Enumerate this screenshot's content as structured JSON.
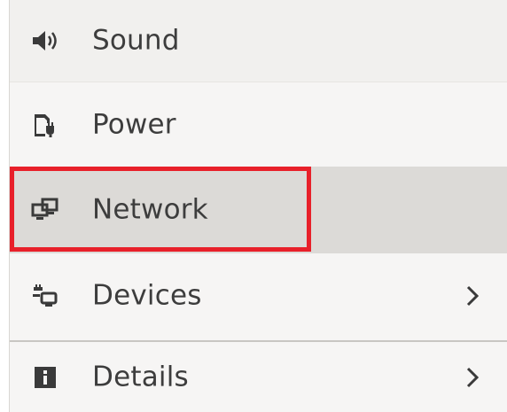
{
  "sidebar": {
    "items": [
      {
        "label": "Sound",
        "icon": "speaker-icon",
        "has_chevron": false
      },
      {
        "label": "Power",
        "icon": "power-plug-icon",
        "has_chevron": false
      },
      {
        "label": "Network",
        "icon": "network-icon",
        "has_chevron": false,
        "selected": true
      },
      {
        "label": "Devices",
        "icon": "devices-icon",
        "has_chevron": true
      },
      {
        "label": "Details",
        "icon": "info-icon",
        "has_chevron": true
      }
    ]
  },
  "colors": {
    "text": "#3d3d3d",
    "icon": "#3a3a3a",
    "selected_bg": "#dcdad7",
    "highlight_border": "#e8202a",
    "panel_bg": "#f6f5f4"
  }
}
